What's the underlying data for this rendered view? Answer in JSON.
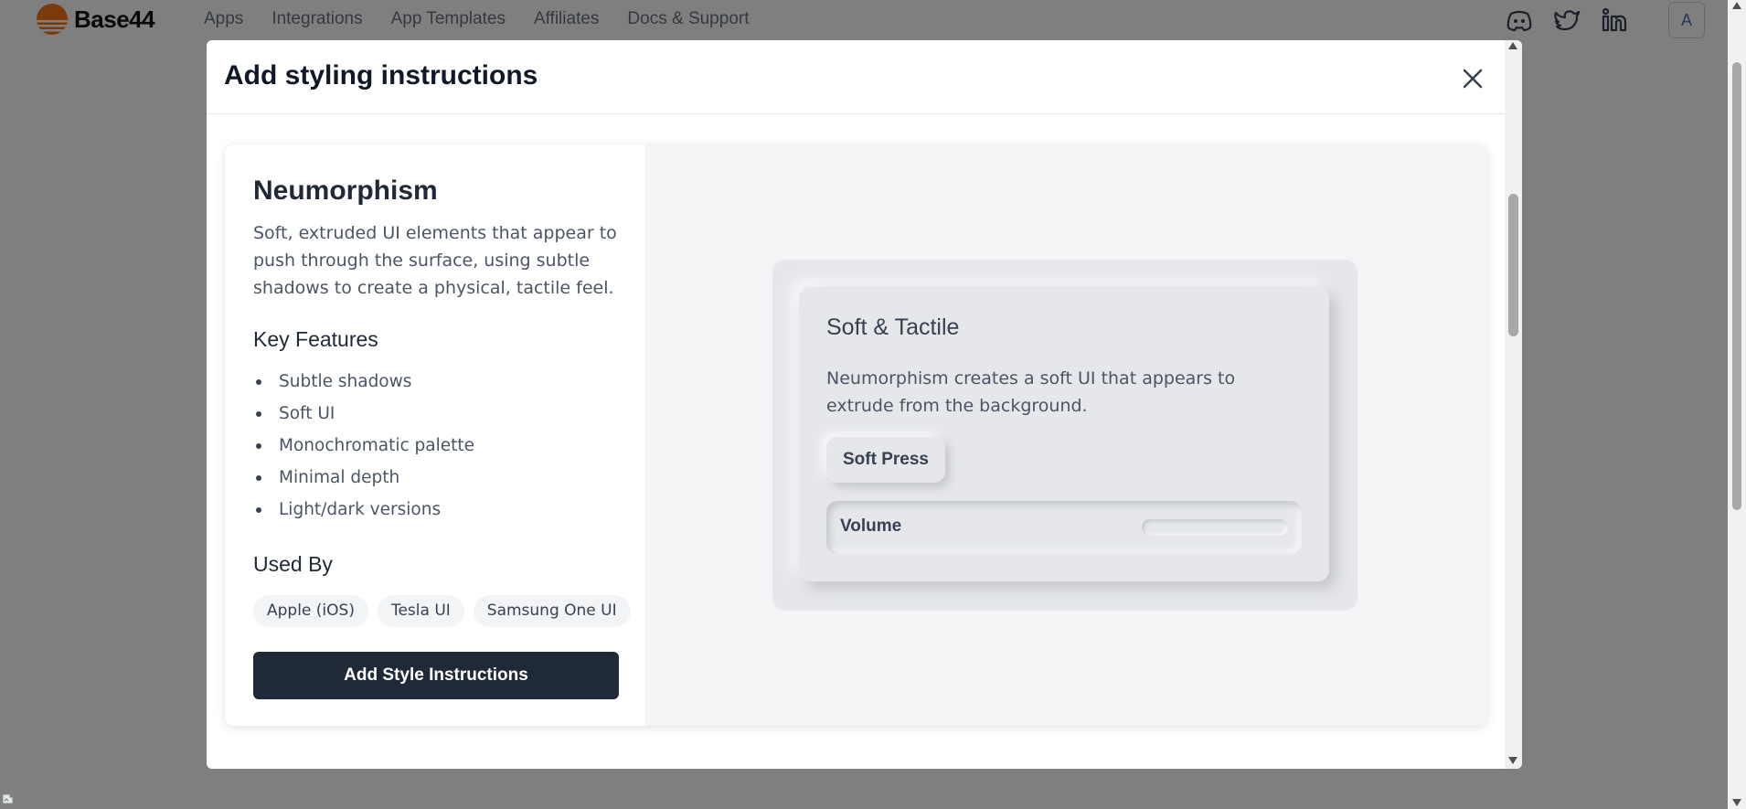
{
  "nav": {
    "brand": "Base44",
    "links": [
      "Apps",
      "Integrations",
      "App Templates",
      "Affiliates",
      "Docs & Support"
    ],
    "icons": [
      "discord-icon",
      "twitter-icon",
      "linkedin-icon"
    ],
    "avatar_initial": "A",
    "brand_color": "#f97316"
  },
  "modal": {
    "title": "Add styling instructions",
    "close_icon": "close-icon"
  },
  "style": {
    "name": "Neumorphism",
    "description": "Soft, extruded UI elements that appear to push through the surface, using subtle shadows to create a physical, tactile feel.",
    "features_heading": "Key Features",
    "features": [
      "Subtle shadows",
      "Soft UI",
      "Monochromatic palette",
      "Minimal depth",
      "Light/dark versions"
    ],
    "used_by_heading": "Used By",
    "used_by": [
      "Apple (iOS)",
      "Tesla UI",
      "Samsung One UI"
    ],
    "add_button": "Add Style Instructions",
    "button_color": "#1f2937"
  },
  "preview": {
    "title": "Soft & Tactile",
    "text": "Neumorphism creates a soft UI that appears to extrude from the background.",
    "button": "Soft Press",
    "slider_label": "Volume",
    "surface_color": "#e5e7eb"
  }
}
